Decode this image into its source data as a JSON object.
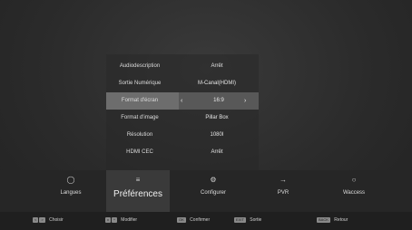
{
  "menu": {
    "rows": [
      {
        "label": "Audiodescription",
        "value": "Arrêt"
      },
      {
        "label": "Sortie Numérique",
        "value": "M-Canal(HDMI)"
      },
      {
        "label": "Format d'écran",
        "value": "16:9"
      },
      {
        "label": "Format d'image",
        "value": "Pillar Box"
      },
      {
        "label": "Résolution",
        "value": "1080I"
      },
      {
        "label": "HDMI CEC",
        "value": "Arrêt"
      }
    ],
    "selected_index": 2
  },
  "categories": [
    {
      "icon": "globe-icon",
      "label": "Langues"
    },
    {
      "icon": "list-icon",
      "label": "Préférences",
      "active": true
    },
    {
      "icon": "gear-icon",
      "label": "Configurer"
    },
    {
      "icon": "usb-icon",
      "label": "PVR"
    },
    {
      "icon": "person-icon",
      "label": "Waccess"
    }
  ],
  "hints": [
    {
      "keys": [
        "<",
        ">"
      ],
      "label": "Choisir"
    },
    {
      "keys": [
        "v",
        "^"
      ],
      "label": "Modifier"
    },
    {
      "keys": [
        "OK"
      ],
      "label": "Confirmer"
    },
    {
      "keys": [
        "EXIT"
      ],
      "label": "Sortie"
    },
    {
      "keys": [
        "BACK"
      ],
      "label": "Retour"
    }
  ],
  "colors": {
    "selected_row": "#6d6d6d",
    "background": "#2a2a2a"
  }
}
